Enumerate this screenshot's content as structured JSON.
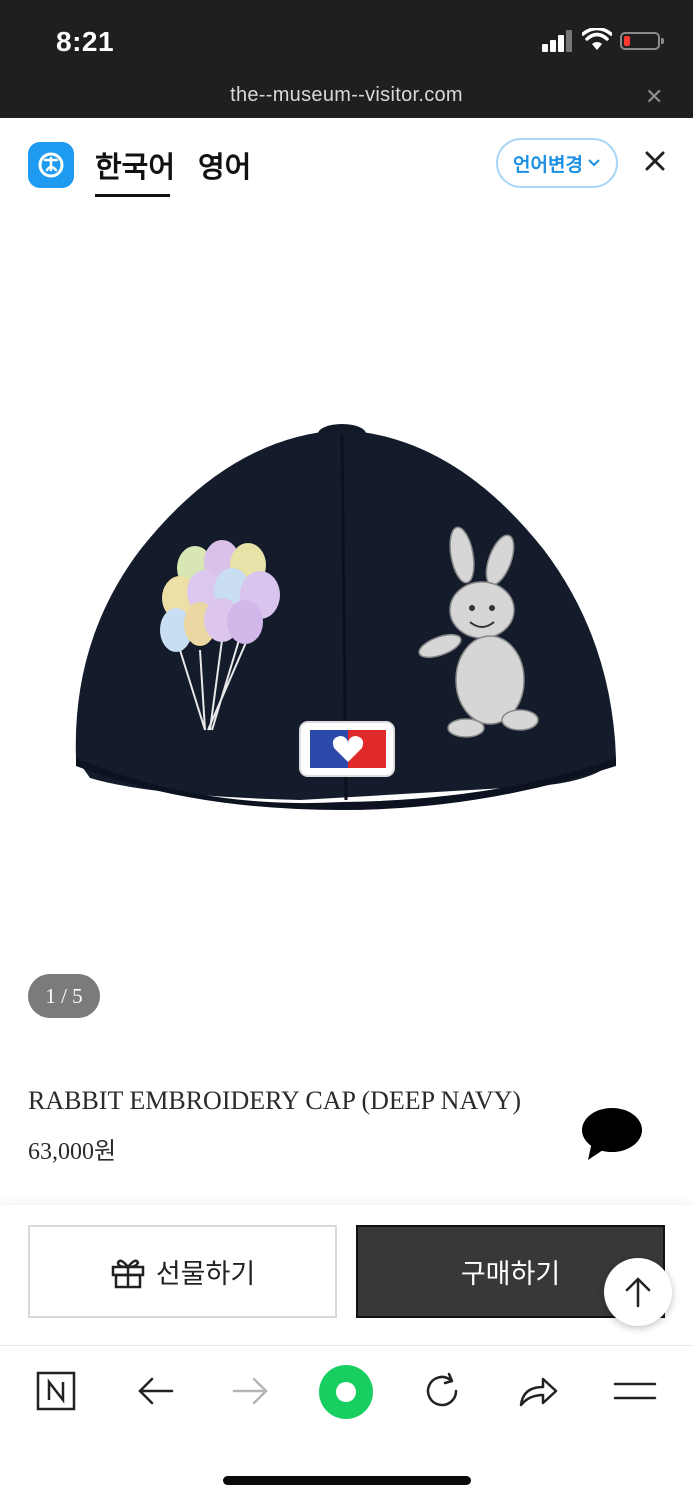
{
  "status_bar": {
    "time": "8:21",
    "url": "the--museum--visitor.com",
    "battery_level": 0.1,
    "battery_color": "#ff3b30"
  },
  "header": {
    "tabs": [
      {
        "label": "한국어",
        "active": true
      },
      {
        "label": "영어",
        "active": false
      }
    ],
    "language_button": "언어변경",
    "accent_color": "#1e9bf0"
  },
  "product": {
    "image_subject": "navy baseball cap, back view, with balloon and rabbit embroidery",
    "pager": "1 / 5",
    "name": "RABBIT EMBROIDERY CAP (DEEP NAVY)",
    "price": "63,000원"
  },
  "actions": {
    "gift_label": "선물하기",
    "buy_label": "구매하기"
  },
  "toolbar": {
    "icons": [
      "naver-n-icon",
      "back-arrow-icon",
      "forward-arrow-icon",
      "green-home-icon",
      "reload-icon",
      "share-icon",
      "menu-icon"
    ],
    "home_color": "#19ce60"
  }
}
